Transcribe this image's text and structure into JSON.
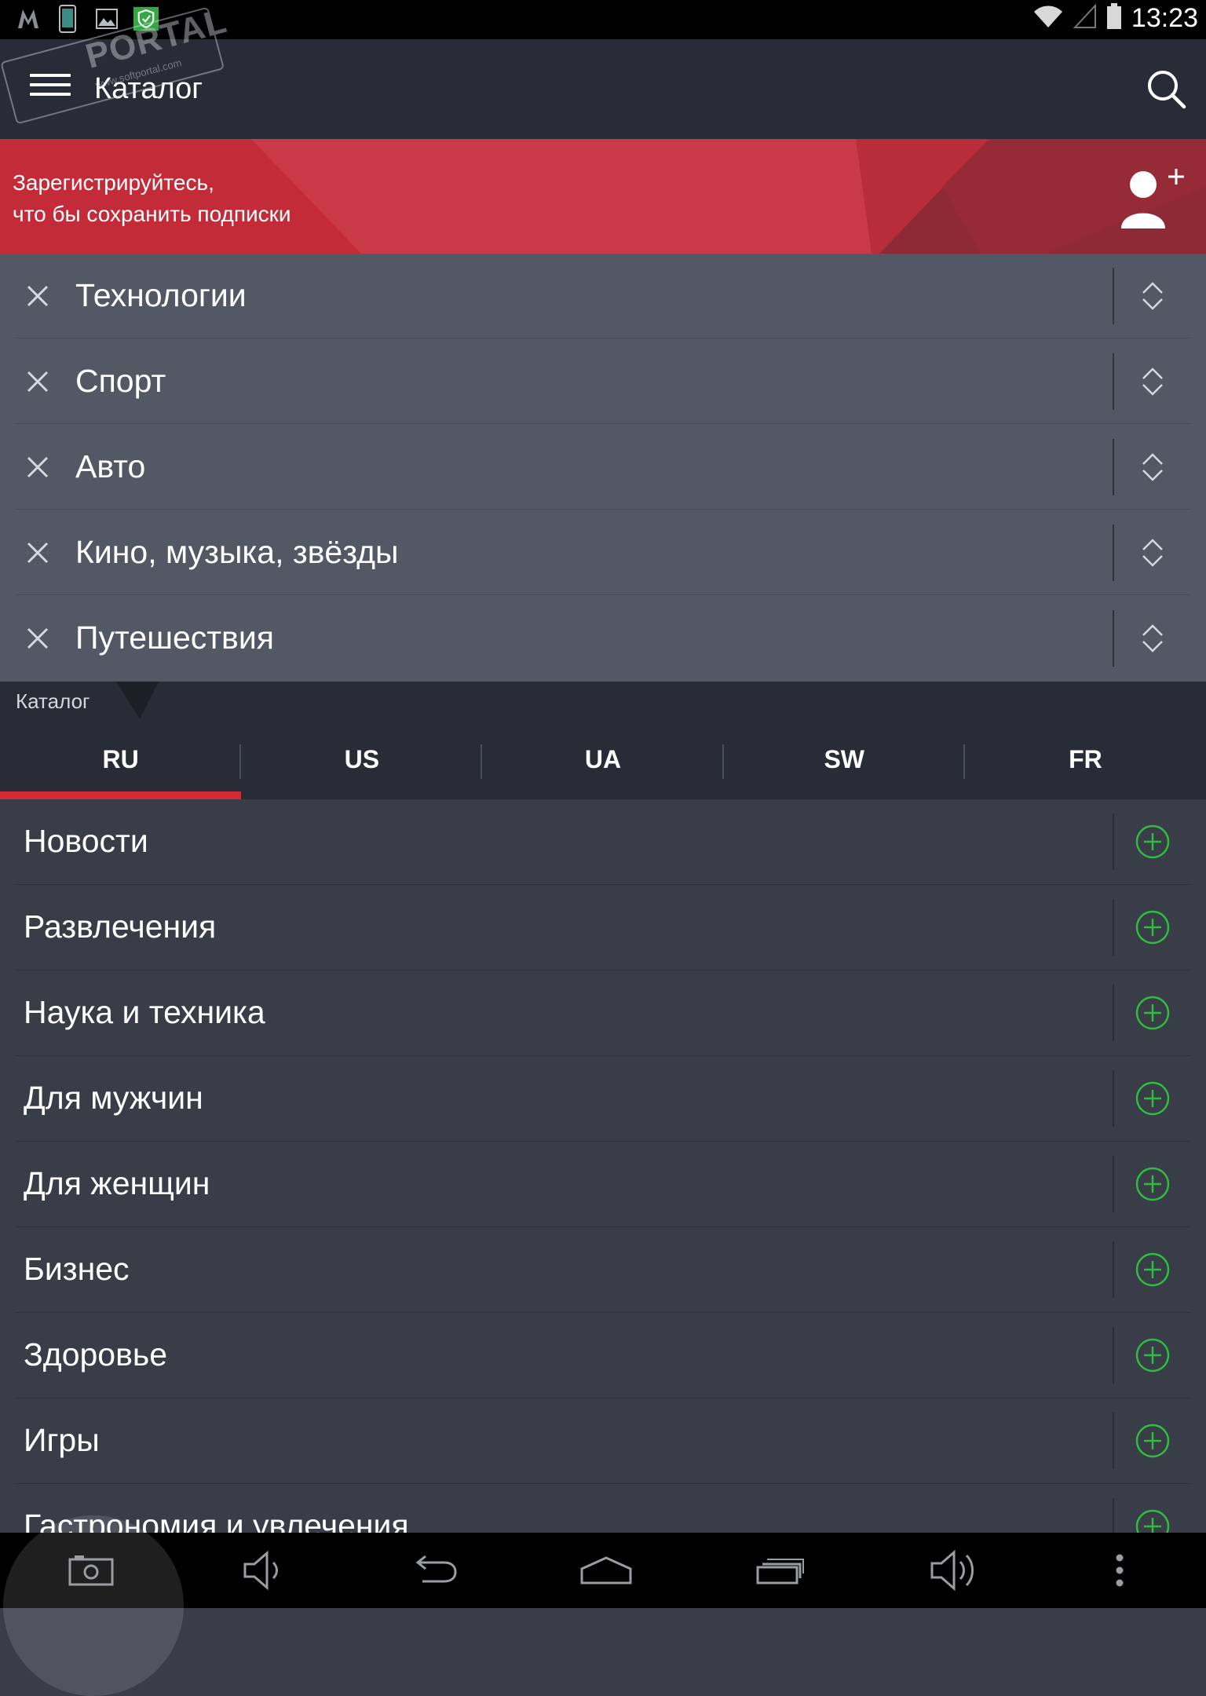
{
  "status_bar": {
    "time": "13:23",
    "left_icons": [
      "notification-m-icon",
      "phone-icon",
      "image-icon",
      "shield-icon"
    ],
    "right_icons": [
      "wifi-icon",
      "signal-icon",
      "battery-icon"
    ]
  },
  "watermark": {
    "text": "PORTAL",
    "sub": "www.softportal.com"
  },
  "app_bar": {
    "title": "Каталог",
    "menu_icon": "hamburger-icon",
    "search_icon": "search-icon"
  },
  "promo": {
    "line1": "Зарегистрируйтесь,",
    "line2": "что бы сохранить подписки",
    "icon": "add-user-icon",
    "colors": {
      "base": "#c42b39",
      "dark": "#8e2a36"
    }
  },
  "subscriptions": {
    "items": [
      {
        "label": "Технологии"
      },
      {
        "label": "Спорт"
      },
      {
        "label": "Авто"
      },
      {
        "label": "Кино, музыка, звёзды"
      },
      {
        "label": "Путешествия"
      }
    ],
    "remove_icon": "close-icon",
    "reorder_icon": "reorder-handle-icon"
  },
  "section": {
    "label": "Каталог"
  },
  "tabs": {
    "active": "RU",
    "items": [
      {
        "label": "RU"
      },
      {
        "label": "US"
      },
      {
        "label": "UA"
      },
      {
        "label": "SW"
      },
      {
        "label": "FR"
      }
    ],
    "accent": "#d22b36"
  },
  "catalog": {
    "add_icon": "plus-circle-icon",
    "add_color": "#2ebd3e",
    "items": [
      {
        "label": "Новости"
      },
      {
        "label": "Развлечения"
      },
      {
        "label": "Наука и техника"
      },
      {
        "label": "Для мужчин"
      },
      {
        "label": "Для женщин"
      },
      {
        "label": "Бизнес"
      },
      {
        "label": "Здоровье"
      },
      {
        "label": "Игры"
      },
      {
        "label": "Гастрономия и увлечения"
      }
    ]
  },
  "nav_bar": {
    "buttons": [
      "screenshot-icon",
      "volume-down-icon",
      "back-icon",
      "home-icon",
      "recents-icon",
      "volume-up-icon",
      "overflow-menu-icon"
    ]
  }
}
